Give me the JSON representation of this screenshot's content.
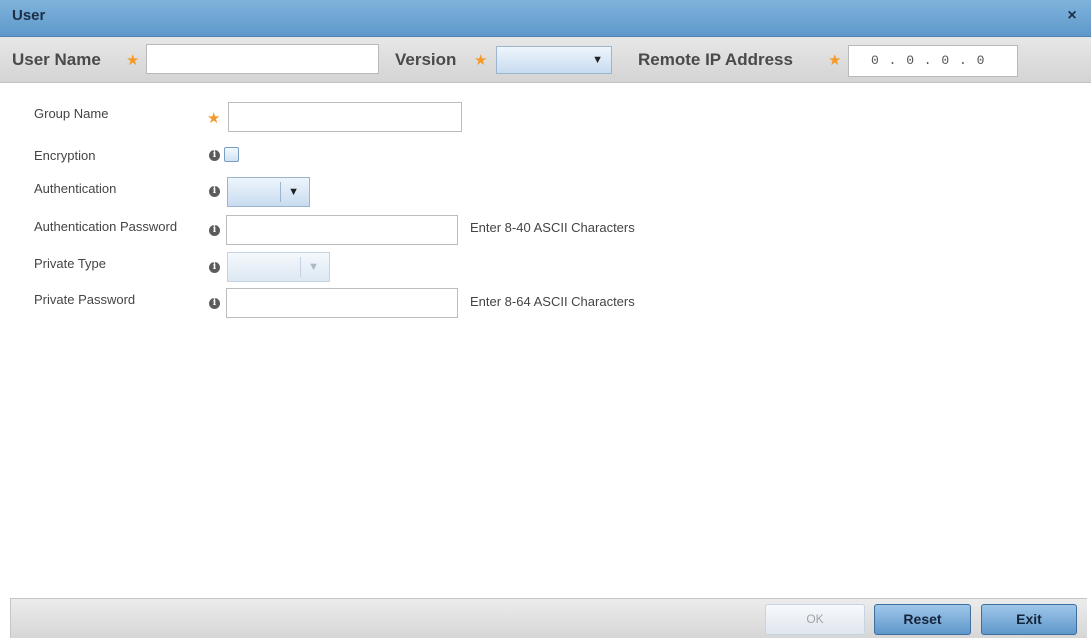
{
  "window": {
    "title": "User",
    "close_glyph": "×"
  },
  "header": {
    "user_name_label": "User Name",
    "user_name_value": "",
    "version_label": "Version",
    "version_value": "",
    "remote_ip_label": "Remote IP Address",
    "remote_ip_value": "0 . 0 . 0 . 0"
  },
  "form": {
    "group_name": {
      "label": "Group Name",
      "value": ""
    },
    "encryption": {
      "label": "Encryption",
      "checked": false
    },
    "authentication": {
      "label": "Authentication",
      "value": ""
    },
    "authentication_password": {
      "label": "Authentication Password",
      "value": "",
      "hint": "Enter 8-40 ASCII Characters"
    },
    "private_type": {
      "label": "Private Type",
      "value": "",
      "disabled": true
    },
    "private_password": {
      "label": "Private Password",
      "value": "",
      "hint": "Enter 8-64 ASCII Characters"
    }
  },
  "footer": {
    "ok_label": "OK",
    "reset_label": "Reset",
    "exit_label": "Exit"
  },
  "colors": {
    "required_star": "#f39a2a",
    "titlebar": "#6fa6d6",
    "button_primary": "#5f97ca"
  },
  "icons": {
    "required": "star-icon",
    "info": "info-icon",
    "dropdown": "chevron-down-icon",
    "close": "close-icon"
  }
}
